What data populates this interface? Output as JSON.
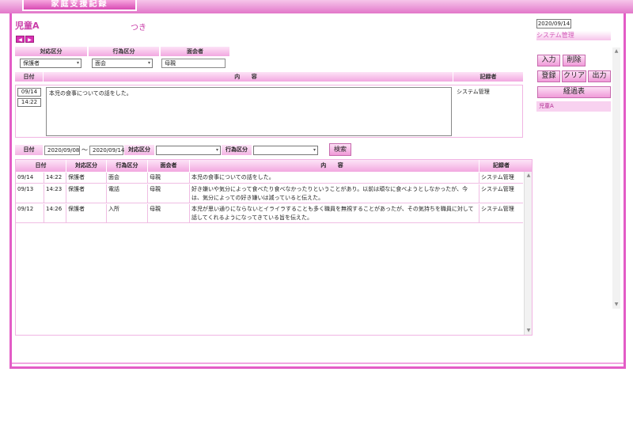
{
  "app": {
    "title": "家庭支援記録"
  },
  "header": {
    "child_name": "児童A",
    "suffix": "つき",
    "prev_icon": "◀",
    "next_icon": "▶"
  },
  "entry": {
    "labels": {
      "response_type": "対応区分",
      "action_type": "行為区分",
      "interviewee": "面会者",
      "date": "日付",
      "content": "内 容",
      "recorder": "記録者"
    },
    "response_type": "保護者",
    "action_type": "面会",
    "interviewee": "母親",
    "date": "09/14",
    "time": "14:22",
    "content": "本児の食事についての話をした。",
    "recorder": "システム管理"
  },
  "search": {
    "date_label": "日付",
    "date_from": "2020/09/08",
    "separator": "～",
    "date_to": "2020/09/14",
    "response_label": "対応区分",
    "action_label": "行為区分",
    "response_value": "",
    "action_value": "",
    "button": "検索"
  },
  "table": {
    "columns": [
      "日付",
      "対応区分",
      "行為区分",
      "面会者",
      "内 容",
      "記録者"
    ],
    "rows": [
      {
        "date": "09/14",
        "time": "14:22",
        "response": "保護者",
        "action": "面会",
        "interviewee": "母親",
        "content": "本児の食事についての話をした。",
        "recorder": "システム管理"
      },
      {
        "date": "09/13",
        "time": "14:23",
        "response": "保護者",
        "action": "電話",
        "interviewee": "母親",
        "content": "好き嫌いや気分によって食べたり食べなかったりということがあり。以前は頑なに食べようとしなかったが、今は、気分によっての好き嫌いは減っていると伝えた。",
        "recorder": "システム管理"
      },
      {
        "date": "09/12",
        "time": "14:26",
        "response": "保護者",
        "action": "入所",
        "interviewee": "母親",
        "content": "本児が思い通りにならないとイライラすることも多く職員を無視することがあったが、その気持ちを職員に対して話してくれるようになってきている旨を伝えた。",
        "recorder": "システム管理"
      }
    ]
  },
  "sidebar": {
    "date": "2020/09/14",
    "staff": "システム管理",
    "buttons": {
      "input": "入力",
      "delete": "削除",
      "register": "登録",
      "clear": "クリア",
      "output": "出力",
      "progress": "経過表"
    },
    "patient": "児童A"
  },
  "icons": {
    "dropdown": "chevron-down-icon",
    "scroll_up": "▲",
    "scroll_down": "▼"
  },
  "colors": {
    "accent": "#e35cc6",
    "header_pink": "#f2a8e0",
    "text_pink": "#c93ca8"
  }
}
